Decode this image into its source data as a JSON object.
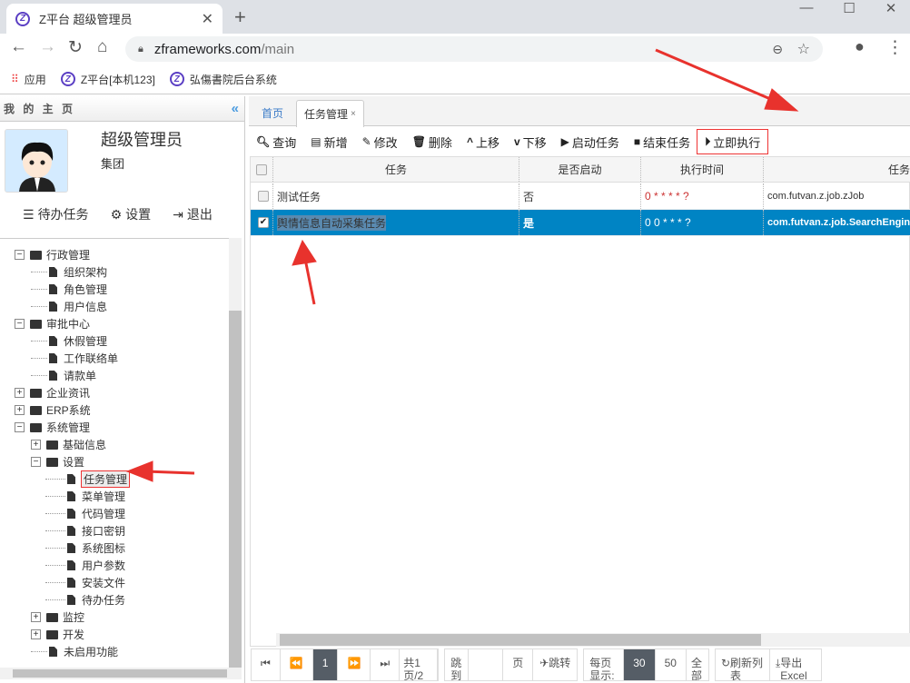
{
  "browser": {
    "tab_title": "Z平台 超级管理员",
    "url_host": "zframeworks.com",
    "url_path": "/main",
    "bookmarks": [
      {
        "label": "应用"
      },
      {
        "label": "Z平台[本机123]"
      },
      {
        "label": "弘傷書院后台系统"
      }
    ]
  },
  "left": {
    "header": "我 的 主 页",
    "username": "超级管理员",
    "org": "集团",
    "links": [
      {
        "icon": "list-icon",
        "label": "待办任务"
      },
      {
        "icon": "gear-icon",
        "label": "设置"
      },
      {
        "icon": "logout-icon",
        "label": "退出"
      }
    ],
    "tree": [
      {
        "label": "行政管理",
        "level": 1,
        "type": "folder",
        "expanded": true
      },
      {
        "label": "组织架构",
        "level": 2,
        "type": "file"
      },
      {
        "label": "角色管理",
        "level": 2,
        "type": "file"
      },
      {
        "label": "用户信息",
        "level": 2,
        "type": "file"
      },
      {
        "label": "审批中心",
        "level": 1,
        "type": "folder",
        "expanded": true
      },
      {
        "label": "休假管理",
        "level": 2,
        "type": "file"
      },
      {
        "label": "工作联络单",
        "level": 2,
        "type": "file"
      },
      {
        "label": "请款单",
        "level": 2,
        "type": "file"
      },
      {
        "label": "企业资讯",
        "level": 1,
        "type": "folder",
        "expanded": false
      },
      {
        "label": "ERP系统",
        "level": 1,
        "type": "folder",
        "expanded": false
      },
      {
        "label": "系统管理",
        "level": 1,
        "type": "folder",
        "expanded": true
      },
      {
        "label": "基础信息",
        "level": 2,
        "type": "folder",
        "expanded": false
      },
      {
        "label": "设置",
        "level": 2,
        "type": "folder",
        "expanded": true
      },
      {
        "label": "任务管理",
        "level": 3,
        "type": "file",
        "selected": true
      },
      {
        "label": "菜单管理",
        "level": 3,
        "type": "file"
      },
      {
        "label": "代码管理",
        "level": 3,
        "type": "file"
      },
      {
        "label": "接口密钥",
        "level": 3,
        "type": "file"
      },
      {
        "label": "系统图标",
        "level": 3,
        "type": "file"
      },
      {
        "label": "用户参数",
        "level": 3,
        "type": "file"
      },
      {
        "label": "安装文件",
        "level": 3,
        "type": "file"
      },
      {
        "label": "待办任务",
        "level": 3,
        "type": "file"
      },
      {
        "label": "监控",
        "level": 1,
        "type": "folder",
        "expanded": false,
        "indent": 2
      },
      {
        "label": "开发",
        "level": 1,
        "type": "folder",
        "expanded": false,
        "indent": 2
      },
      {
        "label": "未启用功能",
        "level": 2,
        "type": "file"
      }
    ]
  },
  "main": {
    "tabs": [
      {
        "label": "首页"
      },
      {
        "label": "任务管理",
        "close": "×"
      }
    ],
    "toolbar": [
      {
        "icon": "search-icon",
        "glyph": "🔍︎",
        "label": "查询"
      },
      {
        "icon": "file-icon",
        "glyph": "▤",
        "label": "新增"
      },
      {
        "icon": "edit-icon",
        "glyph": "✎",
        "label": "修改"
      },
      {
        "icon": "trash-icon",
        "glyph": "🗑︎",
        "label": "删除"
      },
      {
        "icon": "chevron-up-icon",
        "glyph": "^",
        "label": "上移"
      },
      {
        "icon": "chevron-down-icon",
        "glyph": "v",
        "label": "下移"
      },
      {
        "icon": "play-icon",
        "glyph": "▶",
        "label": "启动任务"
      },
      {
        "icon": "stop-icon",
        "glyph": "■",
        "label": "结束任务"
      },
      {
        "icon": "play-circle-icon",
        "glyph": "⏵",
        "label": "立即执行"
      }
    ],
    "columns": [
      "任务",
      "是否启动",
      "执行时间",
      "任务"
    ],
    "rows": [
      {
        "checked": false,
        "name": "测试任务",
        "enabled": "否",
        "cron": "0 * * * * ?",
        "class": "com.futvan.z.job.zJob"
      },
      {
        "checked": true,
        "name": "舆情信息自动采集任务",
        "enabled": "是",
        "cron": "0 0 * * * ?",
        "class": "com.futvan.z.job.SearchEngine"
      }
    ],
    "pager": {
      "page": "1",
      "total": "共1页/2",
      "jump_to": "跳到",
      "page_unit": "页",
      "jump": "跳转",
      "per_page": "每页显示:",
      "size_30": "30",
      "size_50": "50",
      "all": "全部",
      "refresh": "刷新列表",
      "export": "导出Excel"
    }
  },
  "colors": {
    "selected_row": "#0084c4",
    "annotation": "#e8322d",
    "active_page": "#555d66"
  }
}
